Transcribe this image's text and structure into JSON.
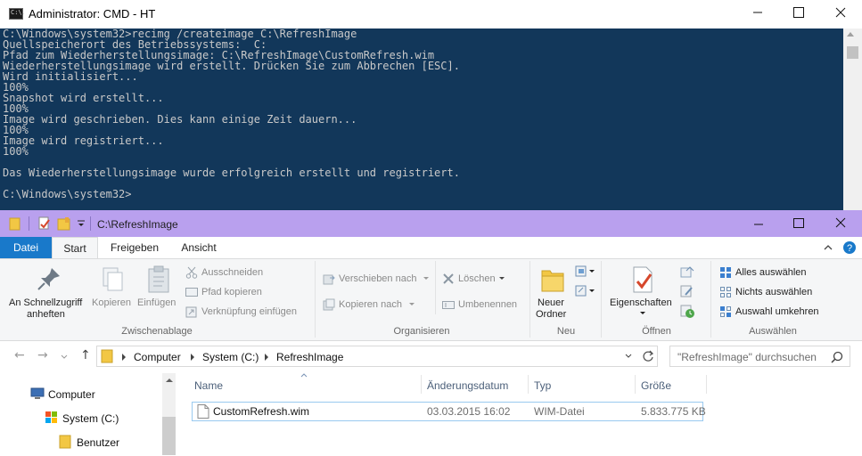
{
  "cmd": {
    "title": "Administrator: CMD - HT",
    "icon_text": "C:\\.",
    "lines": [
      "C:\\Windows\\system32>recimg /createimage C:\\RefreshImage",
      "Quellspeicherort des Betriebssystems:  C:",
      "Pfad zum Wiederherstellungsimage: C:\\RefreshImage\\CustomRefresh.wim",
      "Wiederherstellungsimage wird erstellt. Drücken Sie zum Abbrechen [ESC].",
      "Wird initialisiert...",
      "100%",
      "Snapshot wird erstellt...",
      "100%",
      "Image wird geschrieben. Dies kann einige Zeit dauern...",
      "100%",
      "Image wird registriert...",
      "100%",
      "",
      "Das Wiederherstellungsimage wurde erfolgreich erstellt und registriert.",
      "",
      "C:\\Windows\\system32>"
    ]
  },
  "explorer": {
    "title": "C:\\RefreshImage",
    "tabs": {
      "datei": "Datei",
      "start": "Start",
      "freigeben": "Freigeben",
      "ansicht": "Ansicht"
    },
    "ribbon": {
      "pin_label_1": "An Schnellzugriff",
      "pin_label_2": "anheften",
      "copy": "Kopieren",
      "paste": "Einfügen",
      "cut": "Ausschneiden",
      "copy_path": "Pfad kopieren",
      "paste_shortcut": "Verknüpfung einfügen",
      "group_clipboard": "Zwischenablage",
      "move_to": "Verschieben nach",
      "copy_to": "Kopieren nach",
      "delete": "Löschen",
      "rename": "Umbenennen",
      "group_organize": "Organisieren",
      "new_folder_1": "Neuer",
      "new_folder_2": "Ordner",
      "group_new": "Neu",
      "properties": "Eigenschaften",
      "group_open": "Öffnen",
      "select_all": "Alles auswählen",
      "select_none": "Nichts auswählen",
      "invert_selection": "Auswahl umkehren",
      "group_select": "Auswählen"
    },
    "address": {
      "crumbs": [
        "Computer",
        "System (C:)",
        "RefreshImage"
      ]
    },
    "search_placeholder": "\"RefreshImage\" durchsuchen",
    "nav": {
      "computer": "Computer",
      "system": "System (C:)",
      "benutzer": "Benutzer"
    },
    "columns": {
      "name": "Name",
      "date": "Änderungsdatum",
      "type": "Typ",
      "size": "Größe"
    },
    "files": [
      {
        "name": "CustomRefresh.wim",
        "date": "03.03.2015 16:02",
        "type": "WIM-Datei",
        "size": "5.833.775 KB"
      }
    ]
  },
  "colors": {
    "cmd_bg": "#12375a",
    "explorer_titlebar": "#b9a0ee",
    "datei_tab": "#1979ca"
  }
}
